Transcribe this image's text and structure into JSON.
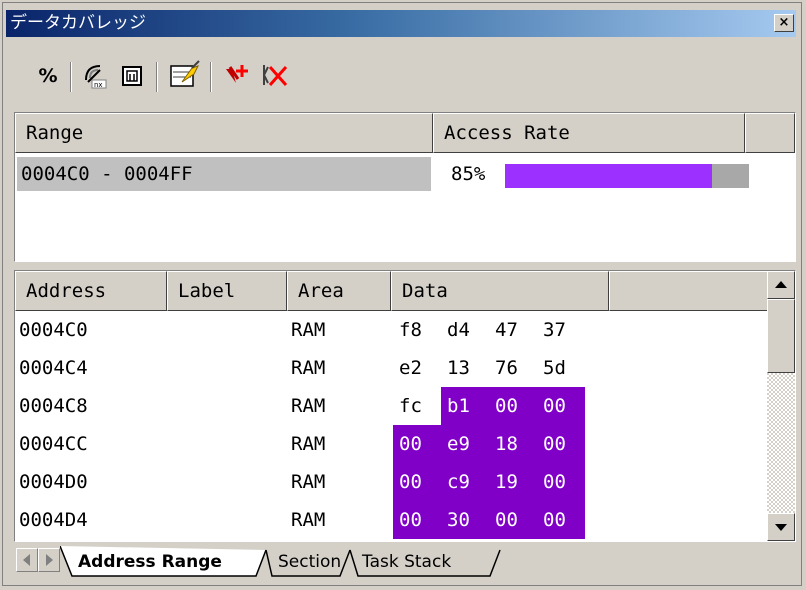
{
  "window": {
    "title": "データカバレッジ",
    "close_label": "×"
  },
  "toolbar": {
    "percent_label": "%"
  },
  "range_table": {
    "columns": [
      "Range",
      "Access Rate"
    ],
    "rows": [
      {
        "range": "0004C0 - 0004FF",
        "rate": "85%",
        "rate_value": 0.85,
        "bar_color": "#9b30ff"
      }
    ]
  },
  "data_table": {
    "columns": [
      "Address",
      "Label",
      "Area",
      "Data"
    ],
    "rows": [
      {
        "address": "0004C0",
        "label": "",
        "area": "RAM",
        "bytes": [
          "f8",
          "d4",
          "47",
          "37"
        ],
        "accessed": [
          false,
          false,
          false,
          false
        ]
      },
      {
        "address": "0004C4",
        "label": "",
        "area": "RAM",
        "bytes": [
          "e2",
          "13",
          "76",
          "5d"
        ],
        "accessed": [
          false,
          false,
          false,
          false
        ]
      },
      {
        "address": "0004C8",
        "label": "",
        "area": "RAM",
        "bytes": [
          "fc",
          "b1",
          "00",
          "00"
        ],
        "accessed": [
          false,
          true,
          true,
          true
        ]
      },
      {
        "address": "0004CC",
        "label": "",
        "area": "RAM",
        "bytes": [
          "00",
          "e9",
          "18",
          "00"
        ],
        "accessed": [
          true,
          true,
          true,
          true
        ]
      },
      {
        "address": "0004D0",
        "label": "",
        "area": "RAM",
        "bytes": [
          "00",
          "c9",
          "19",
          "00"
        ],
        "accessed": [
          true,
          true,
          true,
          true
        ]
      },
      {
        "address": "0004D4",
        "label": "",
        "area": "RAM",
        "bytes": [
          "00",
          "30",
          "00",
          "00"
        ],
        "accessed": [
          true,
          true,
          true,
          true
        ]
      }
    ],
    "highlight_color": "#8000c8"
  },
  "tabs": [
    "Address Range",
    "Section",
    "Task Stack"
  ],
  "active_tab": "Address Range"
}
